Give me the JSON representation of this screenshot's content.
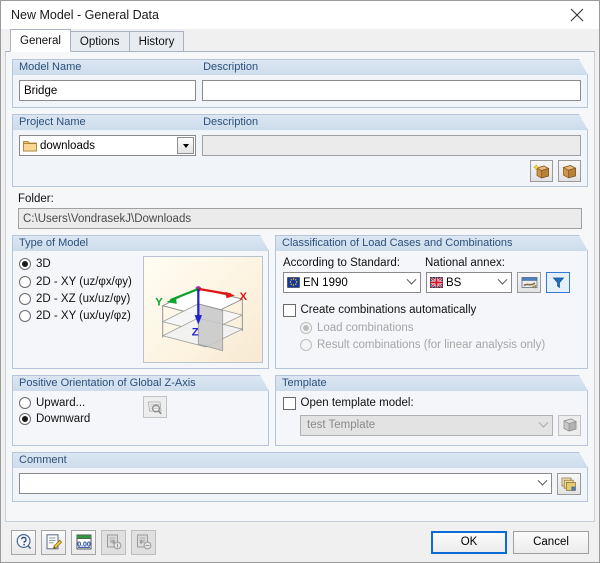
{
  "window": {
    "title": "New Model - General Data",
    "close_icon": "close-icon"
  },
  "tabs": [
    {
      "label": "General",
      "active": true
    },
    {
      "label": "Options",
      "active": false
    },
    {
      "label": "History",
      "active": false
    }
  ],
  "model_name_group": {
    "legend": "Model Name",
    "description_legend": "Description",
    "value": "Bridge",
    "description_value": ""
  },
  "project_group": {
    "legend": "Project Name",
    "description_legend": "Description",
    "value": "downloads",
    "folder_icon": "folder-icon",
    "description_value": "",
    "new_project_button": "new-project-icon",
    "open_project_button": "open-project-icon"
  },
  "folder": {
    "label": "Folder:",
    "path": "C:\\Users\\VondrasekJ\\Downloads"
  },
  "type_of_model": {
    "legend": "Type of Model",
    "options": [
      {
        "label": "3D",
        "selected": true
      },
      {
        "label": "2D - XY (uz/φx/φy)",
        "selected": false
      },
      {
        "label": "2D - XZ (ux/uz/φy)",
        "selected": false
      },
      {
        "label": "2D - XY (ux/uy/φz)",
        "selected": false
      }
    ],
    "preview": {
      "axis_x": "X",
      "axis_y": "Y",
      "axis_z": "Z",
      "color_x": "#e11515",
      "color_y": "#0aa52a",
      "color_z": "#2222cc"
    }
  },
  "classification": {
    "legend": "Classification of Load Cases and Combinations",
    "standard_label": "According to Standard:",
    "standard_value": "EN 1990",
    "standard_icon": "eu-flag-icon",
    "annex_label": "National annex:",
    "annex_value": "BS",
    "annex_icon": "uk-flag-icon",
    "edit_annex_button": "edit-annex-icon",
    "filter_button": "filter-icon",
    "auto_combinations": {
      "label": "Create combinations automatically",
      "checked": false
    },
    "sub_options": [
      {
        "label": "Load combinations",
        "selected": true,
        "disabled": true
      },
      {
        "label": "Result combinations (for linear analysis only)",
        "selected": false,
        "disabled": true
      }
    ]
  },
  "z_axis": {
    "legend": "Positive Orientation of Global Z-Axis",
    "options": [
      {
        "label": "Upward...",
        "selected": false
      },
      {
        "label": "Downward",
        "selected": true
      }
    ],
    "preview_button": "zoom-preview-icon"
  },
  "template": {
    "legend": "Template",
    "open_template_label": "Open template model:",
    "open_template_checked": false,
    "template_value": "test Template",
    "browse_button": "template-browse-icon"
  },
  "comment": {
    "legend": "Comment",
    "value": "",
    "library_button": "comment-library-icon"
  },
  "bottom_bar": {
    "tools": [
      {
        "name": "help-icon",
        "disabled": false
      },
      {
        "name": "edit-note-icon",
        "disabled": false
      },
      {
        "name": "units-calculator-icon",
        "disabled": false
      },
      {
        "name": "import-document-icon",
        "disabled": true
      },
      {
        "name": "export-document-icon",
        "disabled": true
      }
    ],
    "ok_label": "OK",
    "cancel_label": "Cancel"
  },
  "colors": {
    "accent": "#0a6cd4",
    "legend_text": "#2c4f7c",
    "group_header_bg": "#dce6f2"
  }
}
